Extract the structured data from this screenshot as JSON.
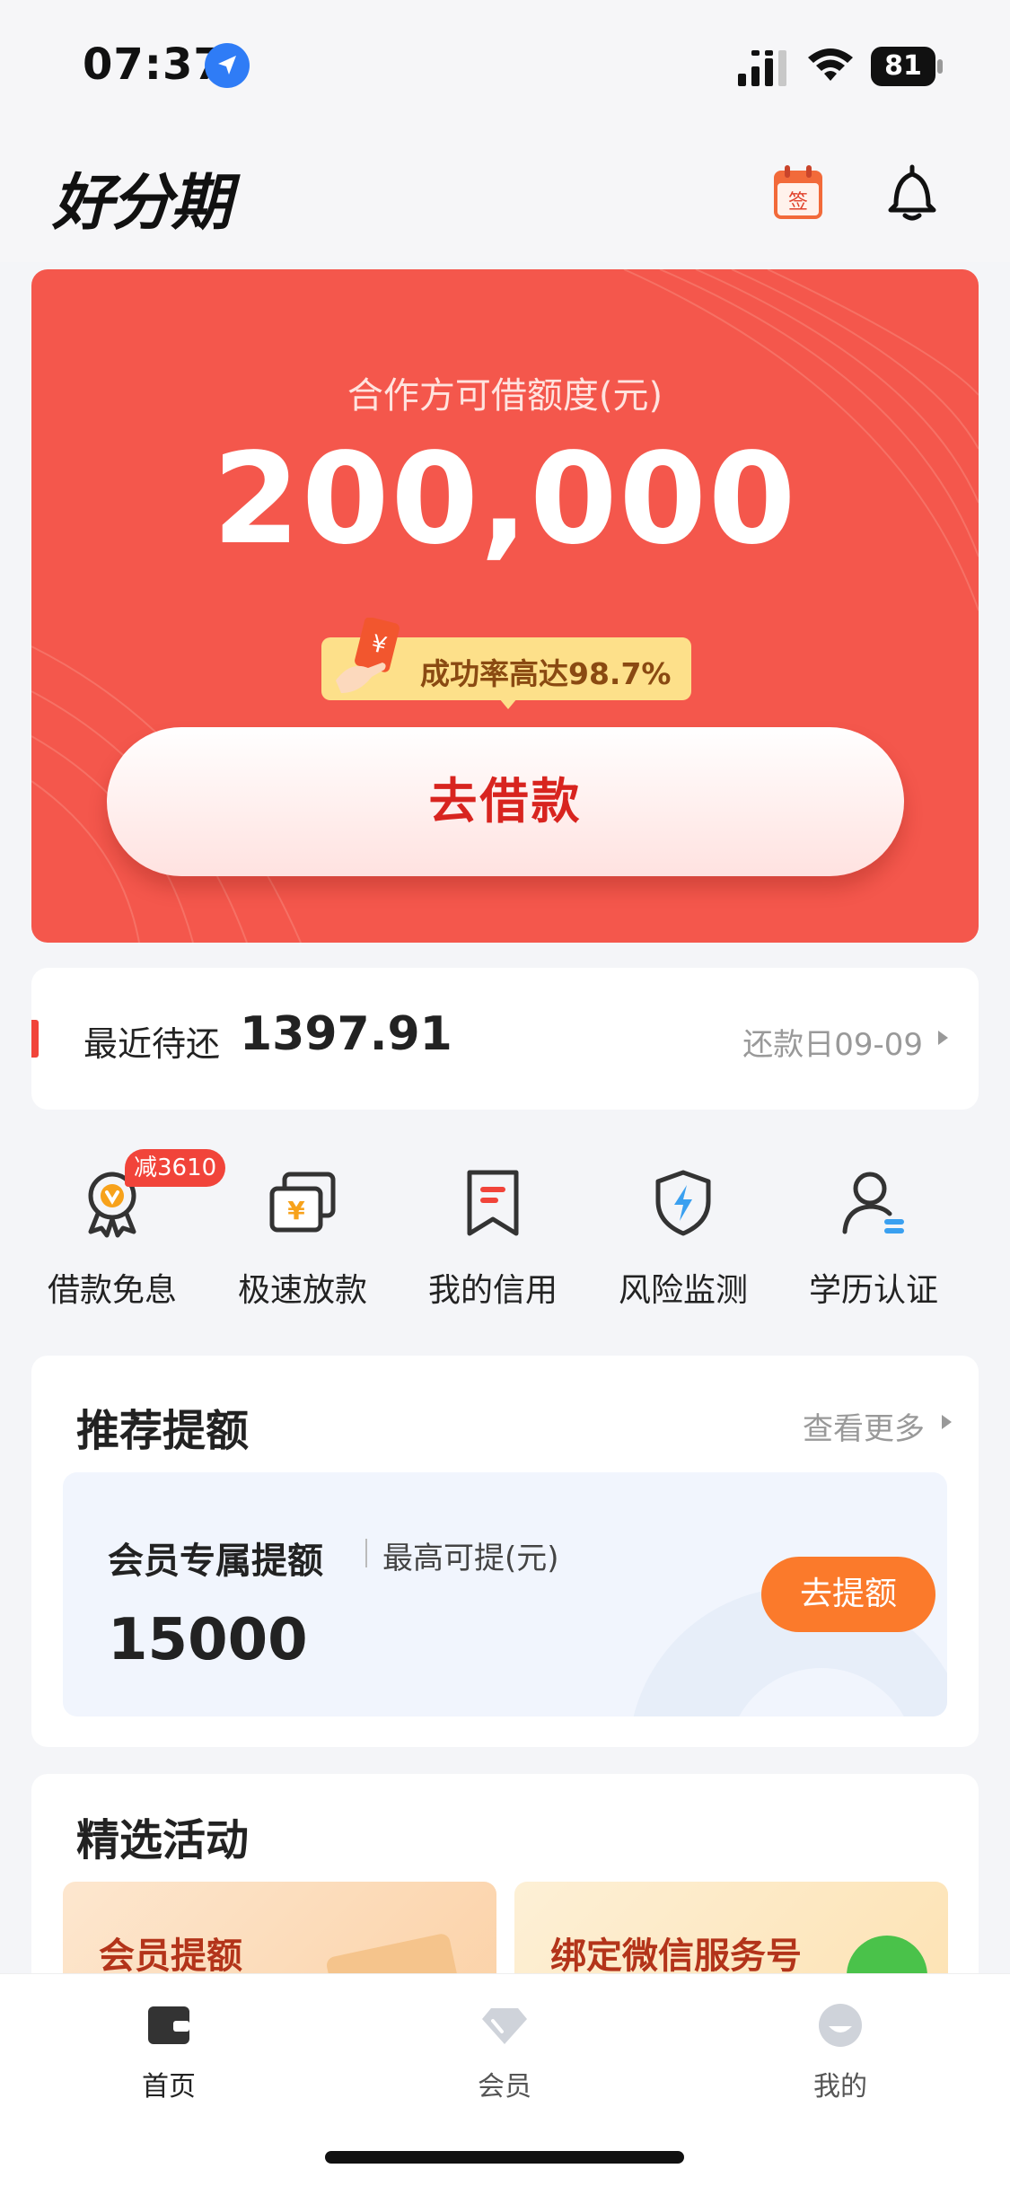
{
  "status_bar": {
    "time": "07:37",
    "battery": "81"
  },
  "header": {
    "app_name": "好分期",
    "sign_icon_text": "签"
  },
  "hero": {
    "label": "合作方可借额度(元)",
    "amount": "200,000",
    "rate_tag": "成功率高达98.7%",
    "borrow_button": "去借款"
  },
  "repayment": {
    "label": "最近待还",
    "amount": "1397.91",
    "due_date": "还款日09-09"
  },
  "quick_actions": [
    {
      "label": "借款免息",
      "icon": "coupon-medal-icon",
      "badge": "减3610"
    },
    {
      "label": "极速放款",
      "icon": "fast-loan-icon"
    },
    {
      "label": "我的信用",
      "icon": "bookmark-icon"
    },
    {
      "label": "风险监测",
      "icon": "shield-bolt-icon"
    },
    {
      "label": "学历认证",
      "icon": "user-verify-icon"
    }
  ],
  "recommend": {
    "title": "推荐提额",
    "more": "查看更多",
    "vip_title": "会员专属提额",
    "vip_sub": "最高可提(元)",
    "vip_amount": "15000",
    "raise_button": "去提额"
  },
  "activities": {
    "title": "精选活动",
    "items": [
      {
        "label": "会员提额"
      },
      {
        "label": "绑定微信服务号"
      }
    ]
  },
  "tab_bar": [
    {
      "label": "首页",
      "icon": "wallet-icon",
      "active": true
    },
    {
      "label": "会员",
      "icon": "diamond-icon",
      "active": false
    },
    {
      "label": "我的",
      "icon": "smile-icon",
      "active": false
    }
  ],
  "colors": {
    "hero_red": "#f4574c",
    "accent_red": "#d8241f",
    "orange": "#fb7a2b",
    "tag_yellow": "#fde08a"
  }
}
